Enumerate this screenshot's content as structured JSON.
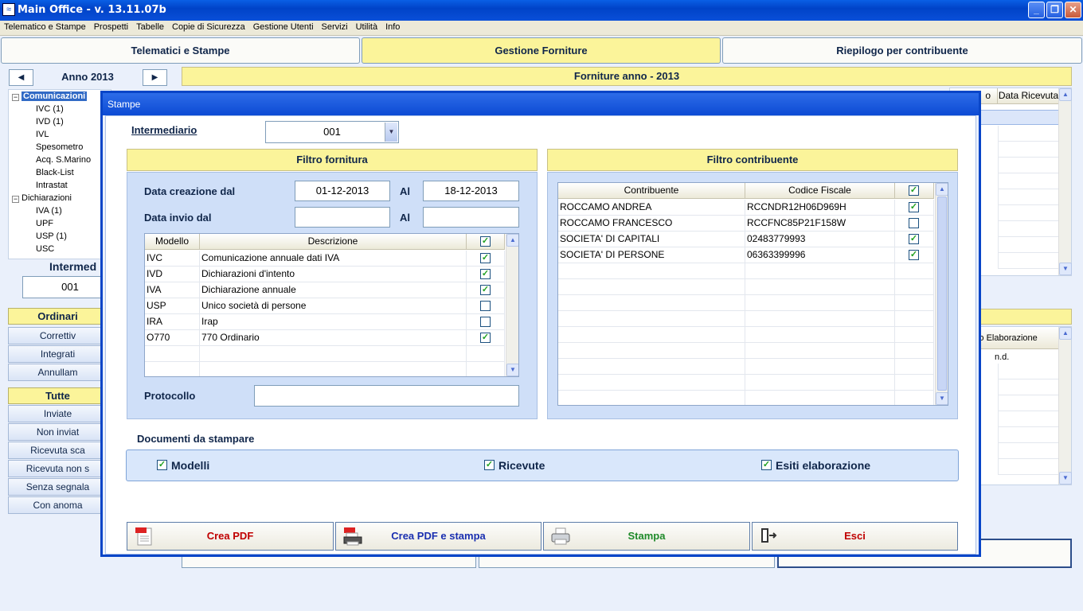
{
  "window": {
    "title": "Main Office  -  v. 13.11.07b",
    "icon": "app-icon"
  },
  "menu": [
    "Telematico e Stampe",
    "Prospetti",
    "Tabelle",
    "Copie di Sicurezza",
    "Gestione Utenti",
    "Servizi",
    "Utilità",
    "Info"
  ],
  "tabs": [
    {
      "label": "Telematici e Stampe",
      "active": false
    },
    {
      "label": "Gestione Forniture",
      "active": true
    },
    {
      "label": "Riepilogo per contribuente",
      "active": false
    }
  ],
  "left": {
    "year_label": "Anno 2013",
    "tree": {
      "comunicazioni": "Comunicazioni",
      "com_items": [
        "IVC (1)",
        "IVD (1)",
        "IVL",
        "Spesometro",
        "Acq. S.Marino",
        "Black-List",
        "Intrastat"
      ],
      "dichiarazioni": "Dichiarazioni",
      "dic_items": [
        "IVA (1)",
        "UPF",
        "USP (1)",
        "USC"
      ]
    },
    "intermediario_label": "Intermed",
    "intermediario_value": "001",
    "group1": [
      "Ordinari",
      "Correttiv",
      "Integrati",
      "Annullam"
    ],
    "group2": [
      "Tutte",
      "Inviate",
      "Non inviat",
      "Ricevuta sca",
      "Ricevuta non s",
      "Senza segnala",
      "Con anoma"
    ]
  },
  "background": {
    "forniture_header": "Forniture anno - 2013",
    "grid1_header_partial": "o",
    "grid1_header": "Data Ricevuta",
    "grid2_header": "ato Elaborazione",
    "grid2_first_value": "n.d."
  },
  "dialog": {
    "title": "Stampe",
    "intermediario_label": "Intermediario",
    "intermediario_value": "001",
    "filtro_fornitura": {
      "title": "Filtro fornitura",
      "data_creazione_label": "Data creazione dal",
      "data_creazione_dal": "01-12-2013",
      "al_label": "Al",
      "data_creazione_al": "18-12-2013",
      "data_invio_label": "Data invio dal",
      "data_invio_dal": "",
      "data_invio_al": "",
      "columns": [
        "Modello",
        "Descrizione"
      ],
      "rows": [
        {
          "modello": "IVC",
          "descrizione": "Comunicazione annuale dati IVA",
          "checked": true
        },
        {
          "modello": "IVD",
          "descrizione": "Dichiarazioni d'intento",
          "checked": true
        },
        {
          "modello": "IVA",
          "descrizione": "Dichiarazione annuale",
          "checked": true
        },
        {
          "modello": "USP",
          "descrizione": "Unico società di persone",
          "checked": false
        },
        {
          "modello": "IRA",
          "descrizione": "Irap",
          "checked": false
        },
        {
          "modello": "O770",
          "descrizione": "770 Ordinario",
          "checked": true
        }
      ],
      "protocollo_label": "Protocollo",
      "protocollo_value": ""
    },
    "filtro_contribuente": {
      "title": "Filtro contribuente",
      "columns": [
        "Contribuente",
        "Codice Fiscale"
      ],
      "rows": [
        {
          "contribuente": "ROCCAMO ANDREA",
          "codice_fiscale": "RCCNDR12H06D969H",
          "checked": true
        },
        {
          "contribuente": "ROCCAMO FRANCESCO",
          "codice_fiscale": "RCCFNC85P21F158W",
          "checked": false
        },
        {
          "contribuente": "SOCIETA' DI CAPITALI",
          "codice_fiscale": "02483779993",
          "checked": true
        },
        {
          "contribuente": "SOCIETA' DI PERSONE",
          "codice_fiscale": "06363399996",
          "checked": true
        }
      ]
    },
    "documenti": {
      "title": "Documenti da stampare",
      "items": [
        {
          "label": "Modelli",
          "checked": true
        },
        {
          "label": "Ricevute",
          "checked": true
        },
        {
          "label": "Esiti elaborazione",
          "checked": true
        }
      ]
    },
    "buttons": [
      {
        "label": "Crea PDF",
        "color": "#c00000",
        "icon": "pdf-icon"
      },
      {
        "label": "Crea PDF e stampa",
        "color": "#1a2fb0",
        "icon": "pdf-print-icon"
      },
      {
        "label": "Stampa",
        "color": "#1f8a2a",
        "icon": "printer-icon"
      },
      {
        "label": "Esci",
        "color": "#c00000",
        "icon": "exit-door-icon"
      }
    ]
  }
}
